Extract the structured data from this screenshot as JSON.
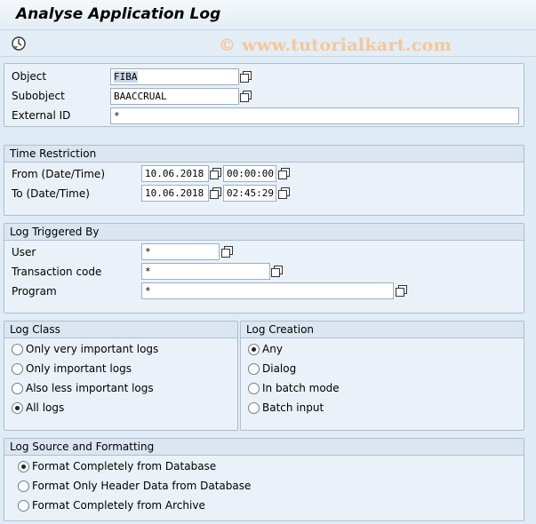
{
  "title": "Analyse Application Log",
  "watermark": "© www.tutorialkart.com",
  "toolbar": {
    "execute_icon": "execute-clock-icon"
  },
  "header_fields": {
    "object_label": "Object",
    "object_value": "FIBA",
    "subobject_label": "Subobject",
    "subobject_value": "BAACCRUAL",
    "external_id_label": "External ID",
    "external_id_value": "*"
  },
  "time_restriction": {
    "title": "Time Restriction",
    "from_label": "From (Date/Time)",
    "from_date": "10.06.2018",
    "from_time": "00:00:00",
    "to_label": "To (Date/Time)",
    "to_date": "10.06.2018",
    "to_time": "02:45:29"
  },
  "log_triggered_by": {
    "title": "Log Triggered By",
    "user_label": "User",
    "user_value": "*",
    "tcode_label": "Transaction code",
    "tcode_value": "*",
    "program_label": "Program",
    "program_value": "*"
  },
  "log_class": {
    "title": "Log Class",
    "options": [
      "Only very important logs",
      "Only important logs",
      "Also less important logs",
      "All logs"
    ],
    "selected": "All logs"
  },
  "log_creation": {
    "title": "Log Creation",
    "options": [
      "Any",
      "Dialog",
      "In batch mode",
      "Batch input"
    ],
    "selected": "Any"
  },
  "log_source": {
    "title": "Log Source and Formatting",
    "options": [
      "Format Completely from Database",
      "Format Only Header Data from Database",
      "Format Completely from Archive"
    ],
    "selected": "Format Completely from Database"
  }
}
